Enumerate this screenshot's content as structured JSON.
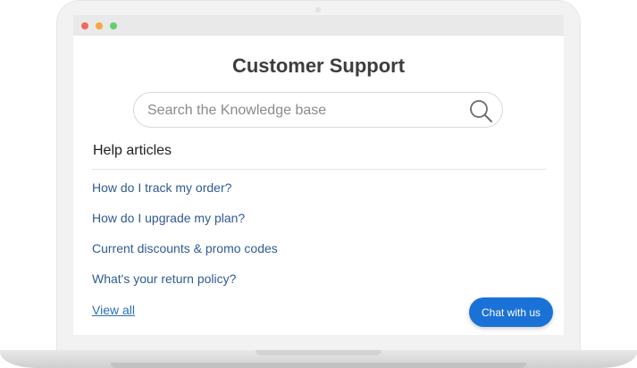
{
  "window": {
    "controls": [
      "close",
      "minimize",
      "maximize"
    ]
  },
  "page": {
    "title": "Customer Support"
  },
  "search": {
    "placeholder": "Search the Knowledge base",
    "value": "",
    "icon": "search-icon"
  },
  "help": {
    "heading": "Help articles",
    "articles": [
      "How do I track my order?",
      "How do I upgrade my plan?",
      "Current discounts & promo codes",
      "What's your return policy?"
    ],
    "view_all_label": "View all"
  },
  "chat": {
    "label": "Chat with us"
  },
  "colors": {
    "accent": "#1b72d6",
    "link": "#2f5b94",
    "title": "#3d3d3d",
    "close_dot": "#ef6a5b",
    "minimize_dot": "#f5a742",
    "maximize_dot": "#63cf72"
  }
}
